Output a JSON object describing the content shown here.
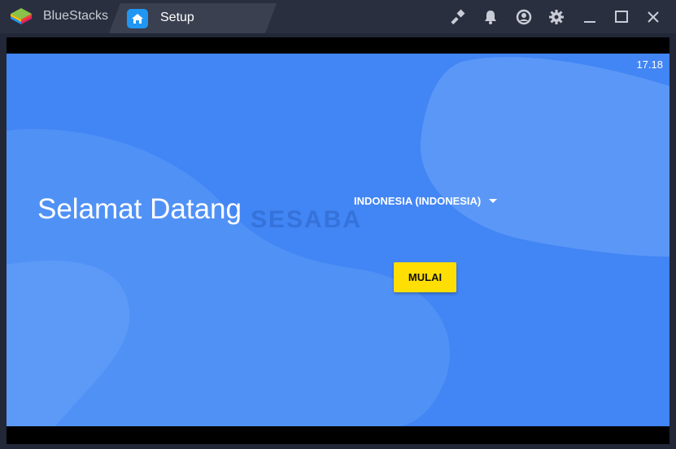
{
  "titlebar": {
    "app_name": "BlueStacks",
    "active_tab": {
      "label": "Setup",
      "icon": "home-icon"
    },
    "controls": [
      "brush-icon",
      "bell-icon",
      "account-icon",
      "gear-icon",
      "minimize-icon",
      "maximize-icon",
      "close-icon"
    ]
  },
  "screen": {
    "clock": "17.18",
    "welcome_title": "Selamat Datang",
    "watermark": "SESABA",
    "language": {
      "selected": "INDONESIA (INDONESIA)",
      "icon": "dropdown-caret-icon"
    },
    "start_label": "MULAI"
  },
  "colors": {
    "titlebar_bg": "#2a2f3f",
    "screen_bg": "#4285f4",
    "blob": "#5d9bf7",
    "start_button": "#ffde03"
  }
}
